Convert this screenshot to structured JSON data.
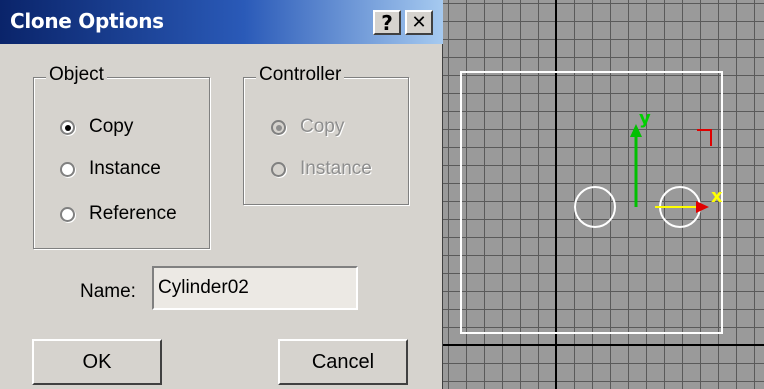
{
  "dialog": {
    "title": "Clone Options",
    "help_glyph": "?",
    "close_glyph": "✕",
    "object_group": {
      "label": "Object",
      "options": [
        {
          "label": "Copy",
          "selected": true
        },
        {
          "label": "Instance",
          "selected": false
        },
        {
          "label": "Reference",
          "selected": false
        }
      ]
    },
    "controller_group": {
      "label": "Controller",
      "enabled": false,
      "options": [
        {
          "label": "Copy",
          "selected": true
        },
        {
          "label": "Instance",
          "selected": false
        }
      ]
    },
    "name_label": "Name:",
    "name_value": "Cylinder02",
    "ok_label": "OK",
    "cancel_label": "Cancel"
  },
  "viewport": {
    "axis_y_label": "y",
    "axis_x_label": "x",
    "colors": {
      "grid_line": "#5a5a5a",
      "grid_bg": "#9a9a9a",
      "axis_green": "#00c000",
      "axis_red": "#e00000",
      "axis_yellow": "#ffff00",
      "selection": "#ffffff"
    }
  }
}
